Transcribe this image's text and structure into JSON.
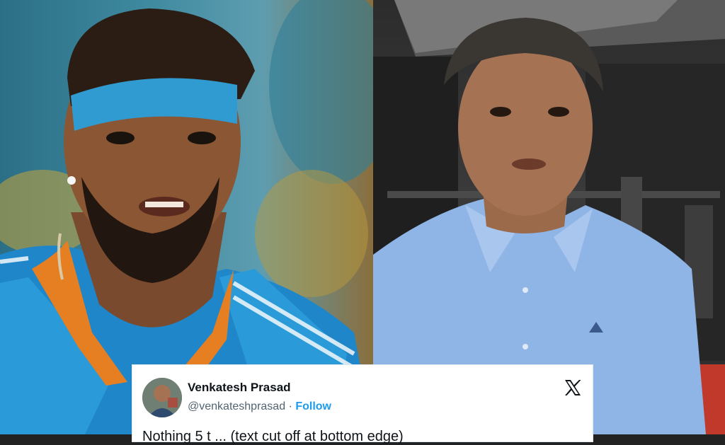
{
  "tweet": {
    "author_name": "Venkatesh Prasad",
    "handle": "@venkateshprasad",
    "separator": " · ",
    "follow_label": "Follow",
    "text_partial": "Nothing 5 t ... (text cut off at bottom edge)"
  },
  "icons": {
    "platform_logo": "x-logo-icon"
  },
  "colors": {
    "follow_blue": "#1d9bf0",
    "card_bg": "#ffffff",
    "name_text": "#0f1419",
    "handle_text": "#536471"
  }
}
